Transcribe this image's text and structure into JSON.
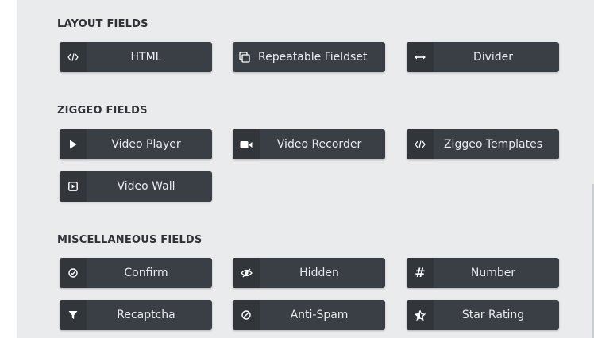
{
  "sections": [
    {
      "title": "LAYOUT FIELDS",
      "items": [
        {
          "label": "HTML",
          "icon": "code-icon"
        },
        {
          "label": "Repeatable Fieldset",
          "icon": "copy-icon"
        },
        {
          "label": "Divider",
          "icon": "horizontal-arrows-icon"
        }
      ]
    },
    {
      "title": "ZIGGEO FIELDS",
      "items": [
        {
          "label": "Video Player",
          "icon": "play-icon"
        },
        {
          "label": "Video Recorder",
          "icon": "video-camera-icon"
        },
        {
          "label": "Ziggeo Templates",
          "icon": "code-icon"
        },
        {
          "label": "Video Wall",
          "icon": "play-square-icon"
        }
      ]
    },
    {
      "title": "MISCELLANEOUS FIELDS",
      "items": [
        {
          "label": "Confirm",
          "icon": "check-circle-icon"
        },
        {
          "label": "Hidden",
          "icon": "eye-slash-icon"
        },
        {
          "label": "Number",
          "icon": "hash-icon"
        },
        {
          "label": "Recaptcha",
          "icon": "filter-icon"
        },
        {
          "label": "Anti-Spam",
          "icon": "ban-icon"
        },
        {
          "label": "Star Rating",
          "icon": "star-half-icon"
        }
      ]
    }
  ],
  "colors": {
    "panel_bg": "#eaebed",
    "button_bg": "#3a3f45",
    "icon_bg": "#32363b",
    "button_text": "#e9ebee",
    "heading_text": "#2f3237"
  }
}
